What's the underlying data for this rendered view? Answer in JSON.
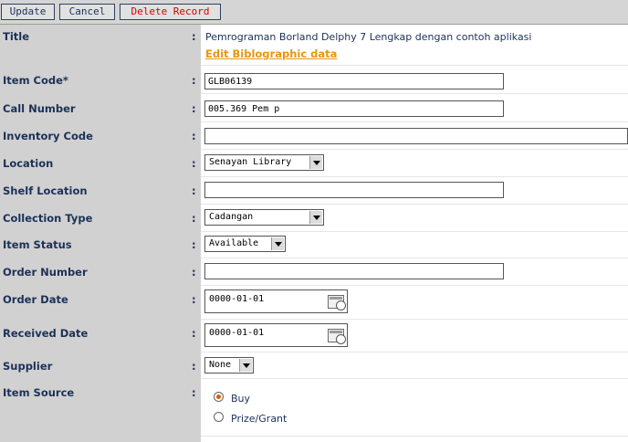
{
  "toolbar": {
    "update_label": "Update",
    "cancel_label": "Cancel",
    "delete_label": "Delete Record"
  },
  "colon": ":",
  "fields": {
    "title": {
      "label": "Title",
      "value": "Pemrograman Borland Delphy 7 Lengkap dengan contoh aplikasi",
      "link": "Edit Biblographic data"
    },
    "item_code": {
      "label": "Item Code*",
      "value": "GLB06139"
    },
    "call_number": {
      "label": "Call Number",
      "value": "005.369 Pem p"
    },
    "inventory_code": {
      "label": "Inventory Code",
      "value": ""
    },
    "location": {
      "label": "Location",
      "value": "Senayan Library"
    },
    "shelf_location": {
      "label": "Shelf Location",
      "value": ""
    },
    "collection_type": {
      "label": "Collection Type",
      "value": "Cadangan"
    },
    "item_status": {
      "label": "Item Status",
      "value": "Available"
    },
    "order_number": {
      "label": "Order Number",
      "value": ""
    },
    "order_date": {
      "label": "Order Date",
      "value": "0000-01-01"
    },
    "received_date": {
      "label": "Received Date",
      "value": "0000-01-01"
    },
    "supplier": {
      "label": "Supplier",
      "value": "None"
    },
    "item_source": {
      "label": "Item Source",
      "options": [
        "Buy",
        "Prize/Grant"
      ],
      "selected": "Buy"
    }
  },
  "icons": {
    "calendar": "calendar-icon",
    "dropdown": "chevron-down-icon"
  },
  "colors": {
    "label_bg": "#d1d1d1",
    "label_text": "#1c3158",
    "link": "#e8960e",
    "danger": "#d40000"
  }
}
